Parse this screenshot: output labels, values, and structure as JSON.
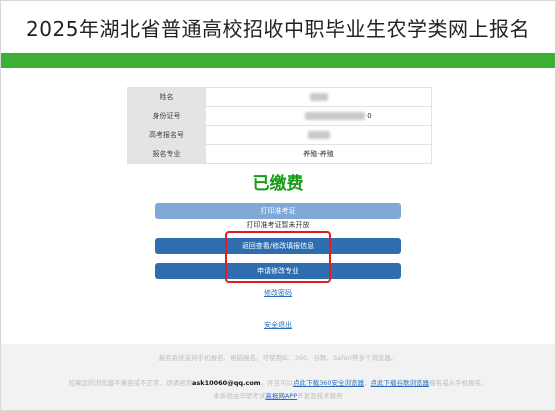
{
  "header": {
    "title": "2025年湖北省普通高校招收中职毕业生农学类网上报名"
  },
  "colors": {
    "brand_green": "#3cb034",
    "paid_green": "#179a17",
    "button_blue": "#2e6db0",
    "highlight_red": "#e61b1b"
  },
  "info": {
    "rows": [
      {
        "label": "姓名",
        "value": ""
      },
      {
        "label": "身份证号",
        "value": "0"
      },
      {
        "label": "高考报名号",
        "value": ""
      },
      {
        "label": "报名专业",
        "value": "养殖-养殖"
      }
    ]
  },
  "status": {
    "paid_text": "已缴费"
  },
  "actions": {
    "print_label": "打印准考证",
    "print_note": "打印准考证暂未开放",
    "edit_label": "返回查看/修改填报信息",
    "change_major_label": "申请修改专业",
    "change_password_label": "修改密码",
    "logout_label": "安全退出"
  },
  "footer": {
    "line1": "报名系统支持手机报名、电脑报名。可使用IE、360、谷歌、Safari等多个浏览器。",
    "line2_pre": "如果您的浏览器不兼容或不正常，烦请咨询",
    "email": "ask10060@qq.com",
    "line2_mid": "。并且可以",
    "link_360": "点此下载360安全浏览器",
    "sep": "，",
    "link_chrome": "点此下载谷歌浏览器",
    "line2_post": "报名或从手机报名。",
    "line3_pre": "本系统由华职考试",
    "link_app": "高报网APP",
    "line3_post": "开发及技术服务"
  }
}
